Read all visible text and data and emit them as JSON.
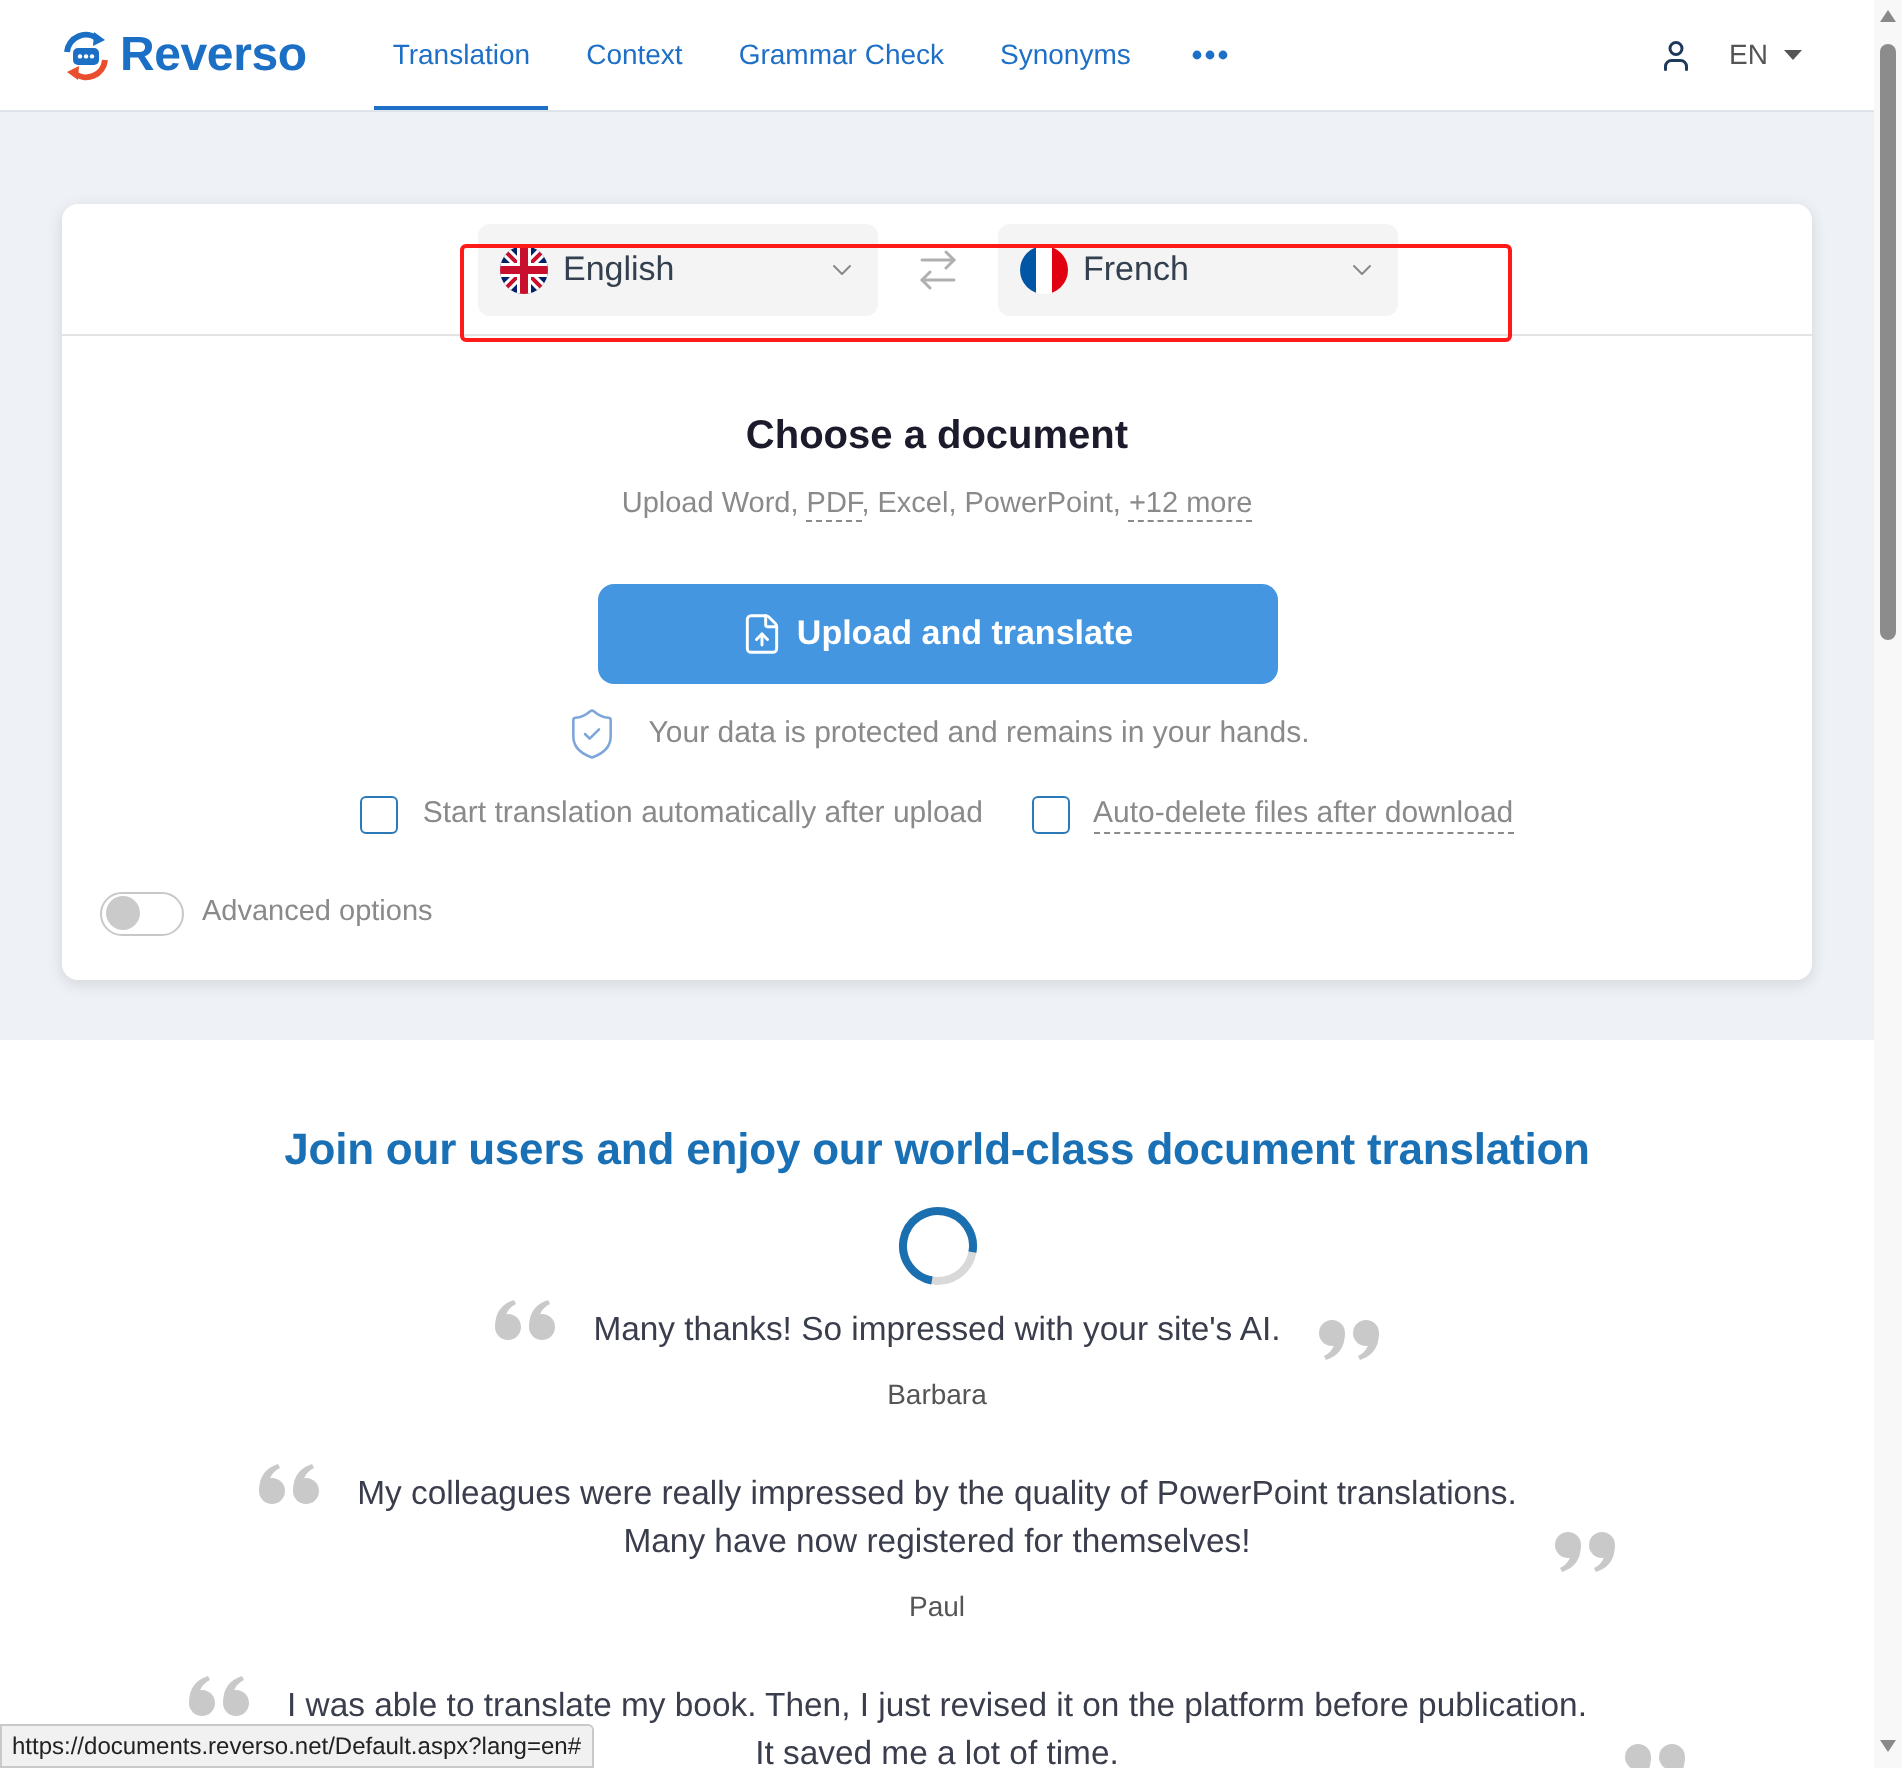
{
  "header": {
    "logo": "Reverso",
    "nav": [
      {
        "label": "Translation",
        "selected": true
      },
      {
        "label": "Context",
        "selected": false
      },
      {
        "label": "Grammar Check",
        "selected": false
      },
      {
        "label": "Synonyms",
        "selected": false
      }
    ],
    "language": "EN"
  },
  "language_bar": {
    "highlighted": true,
    "source": {
      "label": "English",
      "kind": "uk"
    },
    "target": {
      "label": "French",
      "kind": "fr"
    }
  },
  "upload": {
    "title": "Choose a document",
    "formats": [
      {
        "text": "Upload Word, ",
        "kind": "plain"
      },
      {
        "text": "PDF",
        "kind": "link"
      },
      {
        "text": ", Excel, PowerPoint, ",
        "kind": "plain"
      },
      {
        "text": "+12 more",
        "kind": "link"
      }
    ],
    "button": "Upload and translate",
    "security_note": "Your data is protected and remains in your hands.",
    "options": [
      {
        "label": "Start translation automatically after upload",
        "checked": false,
        "kind": "plain"
      },
      {
        "label": "Auto-delete files after download",
        "checked": false,
        "kind": "tooltip"
      }
    ],
    "advanced": {
      "label": "Advanced options",
      "on": false
    }
  },
  "testimonials": {
    "title": "Join our users and enjoy our world-class document translation",
    "items": [
      {
        "lines": [
          "Many thanks! So impressed with your site's AI."
        ],
        "author": "Barbara"
      },
      {
        "lines": [
          "My colleagues were really impressed by the quality of PowerPoint translations.",
          "Many have now registered for themselves!"
        ],
        "author": "Paul"
      },
      {
        "lines": [
          "I was able to translate my book. Then, I just revised it on the platform before publication.",
          "It saved me a lot of time."
        ]
      }
    ]
  },
  "status_bar": {
    "url": "https://documents.reverso.net/Default.aspx?lang=en#"
  }
}
